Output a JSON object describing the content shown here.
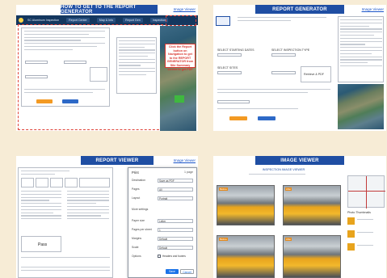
{
  "tiles": {
    "how_to": {
      "banner": "HOW TO GET TO THE REPORT GENERATOR",
      "link": "Image Viewer",
      "app_title": "SC Aluminum Inspection",
      "nav": [
        "Report Center",
        "Map & Info",
        "Report Gen",
        "Inspection"
      ],
      "callout": "Click the Report button on Navigation to get to the REPORT GENERATOR from Site Summary screen to get PDF",
      "highlight_color": "#e0443a"
    },
    "report_generator": {
      "banner": "REPORT GENERATOR",
      "link": "Image Viewer",
      "label_a": "SELECT STARTING DATES",
      "label_b": "SELECT INSPECTION TYPE",
      "label_c": "SELECT SITES",
      "preview_label": "Retrieve & PDF"
    },
    "report_viewer": {
      "banner": "REPORT VIEWER",
      "link": "Image Viewer",
      "pass_label": "Pass",
      "print_rows": [
        {
          "key": "Destination",
          "value": "Save as PDF"
        },
        {
          "key": "Pages",
          "value": "All"
        },
        {
          "key": "Layout",
          "value": "Portrait"
        },
        {
          "key": "More settings",
          "value": ""
        },
        {
          "key": "Paper size",
          "value": "Letter"
        },
        {
          "key": "Pages per sheet",
          "value": "1"
        },
        {
          "key": "Margins",
          "value": "Default"
        },
        {
          "key": "Scale",
          "value": "Default"
        },
        {
          "key": "Options",
          "value": "Headers and footers"
        }
      ],
      "print_title": "Print",
      "print_pages": "1 page",
      "save_button": "Save",
      "cancel_button": "Cancel"
    },
    "image_viewer": {
      "banner": "IMAGE VIEWER",
      "subtitle": "INSPECTION IMAGE VIEWER",
      "thumb_labels": [
        "Before",
        "After",
        "Before",
        "After"
      ],
      "side_title": "Photo Thumbnails"
    }
  }
}
